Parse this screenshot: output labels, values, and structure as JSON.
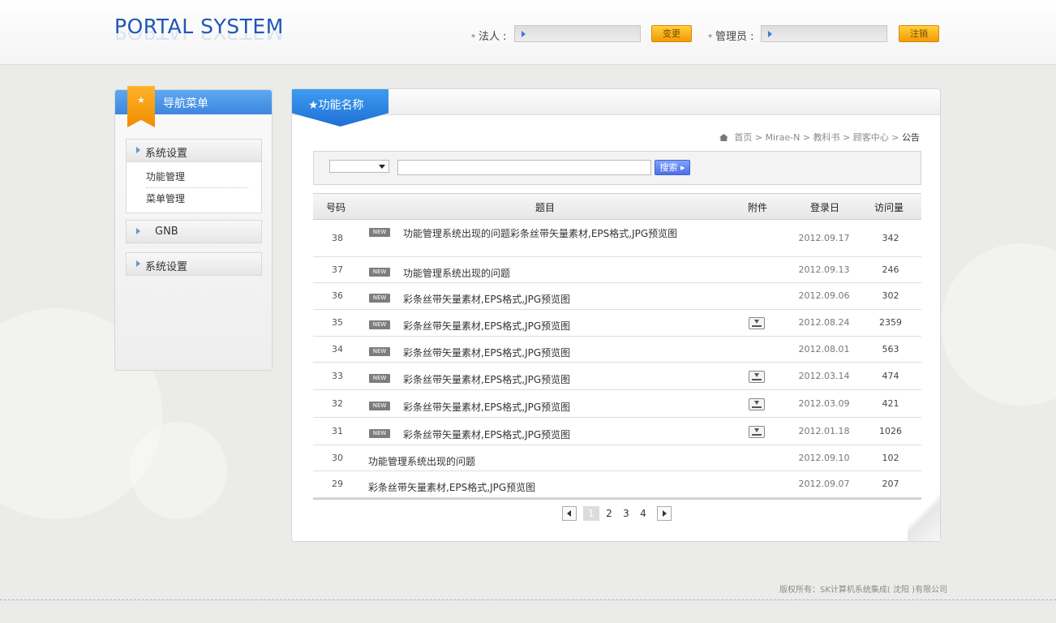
{
  "header": {
    "logo": "PORTAL SYSTEM",
    "legal_label": "法人 :",
    "legal_value": "",
    "change_button": "变更",
    "admin_label": "管理员 :",
    "admin_value": "",
    "logout_button": "注销",
    "required_mark": "*"
  },
  "sidebar": {
    "title": "导航菜单",
    "star": "★",
    "groups": [
      {
        "label": "系统设置",
        "items": [
          "功能管理",
          "菜单管理"
        ]
      },
      {
        "label": "GNB"
      },
      {
        "label": "系统设置"
      }
    ]
  },
  "main": {
    "tab_title": "★功能名称",
    "breadcrumb": {
      "items": [
        "首页",
        "Mirae-N",
        "教科书",
        "顾客中心"
      ],
      "current": "公告",
      "separator": ">"
    },
    "search": {
      "select_value": "",
      "input_value": "",
      "button_label": "搜索 ▸"
    },
    "table": {
      "headers": [
        "号码",
        "题目",
        "附件",
        "登录日",
        "访问量"
      ],
      "new_badge": "NEW",
      "rows": [
        {
          "no": "38",
          "title": "功能管理系统出现的问题彩条丝带矢量素材,EPS格式,JPG预览图",
          "new": true,
          "attachment": false,
          "date": "2012.09.17",
          "views": "342"
        },
        {
          "no": "37",
          "title": "功能管理系统出现的问题",
          "new": true,
          "attachment": false,
          "date": "2012.09.13",
          "views": "246"
        },
        {
          "no": "36",
          "title": "彩条丝带矢量素材,EPS格式,JPG预览图",
          "new": true,
          "attachment": false,
          "date": "2012.09.06",
          "views": "302"
        },
        {
          "no": "35",
          "title": "彩条丝带矢量素材,EPS格式,JPG预览图",
          "new": true,
          "attachment": true,
          "date": "2012.08.24",
          "views": "2359"
        },
        {
          "no": "34",
          "title": "彩条丝带矢量素材,EPS格式,JPG预览图",
          "new": true,
          "attachment": false,
          "date": "2012.08.01",
          "views": "563"
        },
        {
          "no": "33",
          "title": "彩条丝带矢量素材,EPS格式,JPG预览图",
          "new": true,
          "attachment": true,
          "date": "2012.03.14",
          "views": "474"
        },
        {
          "no": "32",
          "title": "彩条丝带矢量素材,EPS格式,JPG预览图",
          "new": true,
          "attachment": true,
          "date": "2012.03.09",
          "views": "421"
        },
        {
          "no": "31",
          "title": "彩条丝带矢量素材,EPS格式,JPG预览图",
          "new": true,
          "attachment": true,
          "date": "2012.01.18",
          "views": "1026"
        },
        {
          "no": "30",
          "title": "功能管理系统出现的问题",
          "new": false,
          "attachment": false,
          "date": "2012.09.10",
          "views": "102"
        },
        {
          "no": "29",
          "title": "彩条丝带矢量素材,EPS格式,JPG预览图",
          "new": false,
          "attachment": false,
          "date": "2012.09.07",
          "views": "207"
        }
      ]
    },
    "pager": {
      "pages": [
        "1",
        "2",
        "3",
        "4"
      ],
      "current": "1"
    }
  },
  "footer": {
    "copyright": "版权所有：SK计算机系统集成( 沈阳 )有限公司"
  },
  "colors": {
    "brand_blue": "#1f55b8",
    "accent_orange": "#f29b06",
    "search_blue": "#4e6fe8"
  }
}
